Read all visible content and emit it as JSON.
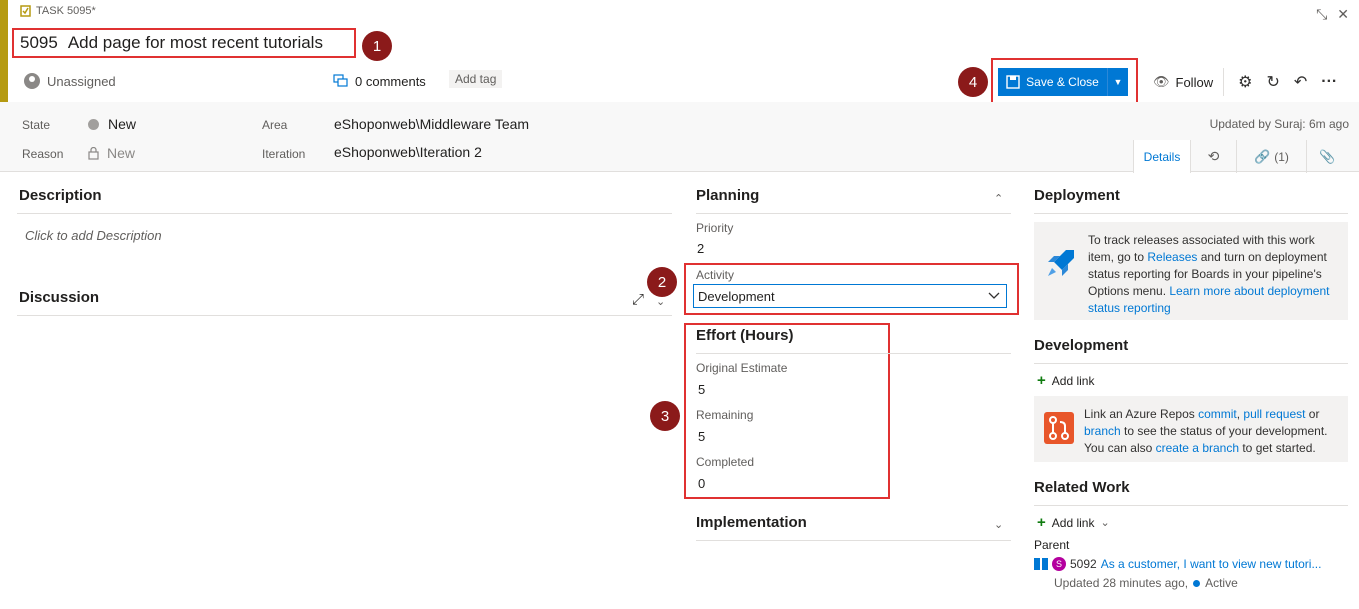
{
  "header": {
    "work_item_type": "TASK 5095*",
    "id": "5095",
    "title": "Add page for most recent tutorials",
    "assigned": "Unassigned",
    "comments": "0 comments",
    "add_tag": "Add tag"
  },
  "toolbar": {
    "save_close": "Save & Close",
    "follow": "Follow"
  },
  "callouts": [
    "1",
    "2",
    "3",
    "4"
  ],
  "fields": {
    "state_label": "State",
    "state_value": "New",
    "reason_label": "Reason",
    "reason_value": "New",
    "area_label": "Area",
    "area_value": "eShoponweb\\Middleware Team",
    "iteration_label": "Iteration",
    "iteration_value": "eShoponweb\\Iteration 2",
    "updated": "Updated by Suraj: 6m ago"
  },
  "tabs": {
    "details": "Details",
    "links": "(1)"
  },
  "description": {
    "title": "Description",
    "placeholder": "Click to add Description"
  },
  "discussion": {
    "title": "Discussion"
  },
  "planning": {
    "title": "Planning",
    "priority_label": "Priority",
    "priority_value": "2",
    "activity_label": "Activity",
    "activity_value": "Development"
  },
  "effort": {
    "title": "Effort (Hours)",
    "original_label": "Original Estimate",
    "original_value": "5",
    "remaining_label": "Remaining",
    "remaining_value": "5",
    "completed_label": "Completed",
    "completed_value": "0"
  },
  "implementation": {
    "title": "Implementation"
  },
  "deployment": {
    "title": "Deployment",
    "text1": "To track releases associated with this work item, go to ",
    "releases_link": "Releases",
    "text2": " and turn on deployment status reporting for Boards in your pipeline's Options menu. ",
    "learn_link": "Learn more about deployment status reporting"
  },
  "development": {
    "title": "Development",
    "add_link": "Add link",
    "text1": "Link an Azure Repos ",
    "commit_link": "commit",
    "sep1": ", ",
    "pr_link": "pull request",
    "text2": " or ",
    "branch_link": "branch",
    "text3": " to see the status of your development. You can also ",
    "create_link": "create a branch",
    "text4": " to get started."
  },
  "related": {
    "title": "Related Work",
    "add_link": "Add link",
    "parent_label": "Parent",
    "parent_avatar": "S",
    "parent_id": "5092",
    "parent_title": "As a customer, I want to view new tutori...",
    "parent_updated": "Updated 28 minutes ago,",
    "parent_state": "Active"
  },
  "colors": {
    "accent_task": "#b59a11",
    "primary": "#0078d4",
    "annotation_red": "#e03131",
    "callout": "#8b1a1a",
    "active_state": "#0078d4"
  }
}
